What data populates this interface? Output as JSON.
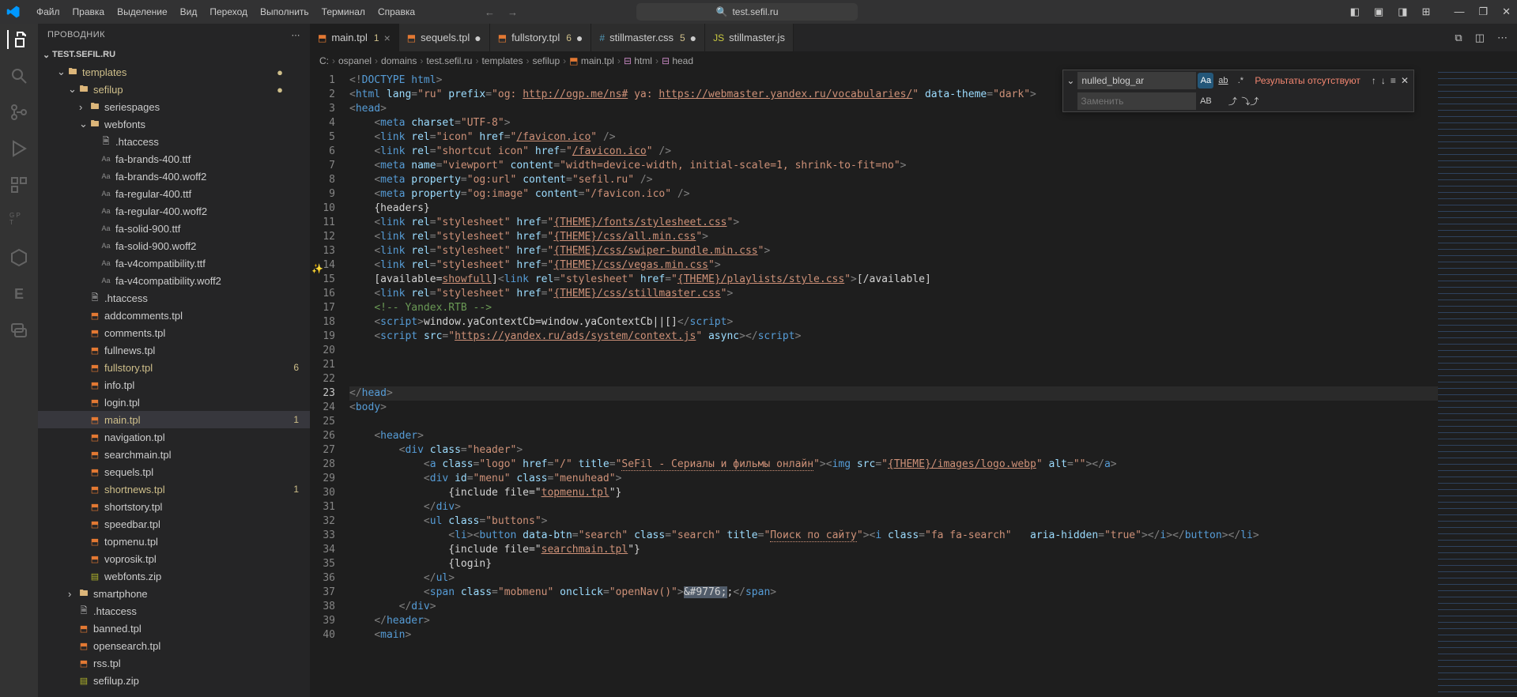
{
  "titlebar": {
    "menu": [
      "Файл",
      "Правка",
      "Выделение",
      "Вид",
      "Переход",
      "Выполнить",
      "Терминал",
      "Справка"
    ],
    "url": "test.sefil.ru"
  },
  "sidebar": {
    "title": "ПРОВОДНИК",
    "project": "TEST.SEFIL.RU",
    "tree": [
      {
        "depth": 1,
        "chev": "v",
        "icon": "folder",
        "label": "templates",
        "dim": true,
        "dot": "#cfbf8a"
      },
      {
        "depth": 2,
        "chev": "v",
        "icon": "folder",
        "label": "sefilup",
        "dim": true,
        "dot": "#cfbf8a"
      },
      {
        "depth": 3,
        "chev": ">",
        "icon": "folder",
        "label": "seriespages"
      },
      {
        "depth": 3,
        "chev": "v",
        "icon": "folder",
        "label": "webfonts"
      },
      {
        "depth": 4,
        "icon": "file",
        "label": ".htaccess"
      },
      {
        "depth": 4,
        "icon": "font",
        "label": "fa-brands-400.ttf"
      },
      {
        "depth": 4,
        "icon": "font",
        "label": "fa-brands-400.woff2"
      },
      {
        "depth": 4,
        "icon": "font",
        "label": "fa-regular-400.ttf"
      },
      {
        "depth": 4,
        "icon": "font",
        "label": "fa-regular-400.woff2"
      },
      {
        "depth": 4,
        "icon": "font",
        "label": "fa-solid-900.ttf"
      },
      {
        "depth": 4,
        "icon": "font",
        "label": "fa-solid-900.woff2"
      },
      {
        "depth": 4,
        "icon": "font",
        "label": "fa-v4compatibility.ttf"
      },
      {
        "depth": 4,
        "icon": "font",
        "label": "fa-v4compatibility.woff2"
      },
      {
        "depth": 3,
        "icon": "file",
        "label": ".htaccess"
      },
      {
        "depth": 3,
        "icon": "html5",
        "label": "addcomments.tpl"
      },
      {
        "depth": 3,
        "icon": "html5",
        "label": "comments.tpl"
      },
      {
        "depth": 3,
        "icon": "html5",
        "label": "fullnews.tpl"
      },
      {
        "depth": 3,
        "icon": "html5",
        "label": "fullstory.tpl",
        "dim": true,
        "badge": "6"
      },
      {
        "depth": 3,
        "icon": "html5",
        "label": "info.tpl"
      },
      {
        "depth": 3,
        "icon": "html5",
        "label": "login.tpl"
      },
      {
        "depth": 3,
        "icon": "html5",
        "label": "main.tpl",
        "dim": true,
        "badge": "1",
        "selected": true
      },
      {
        "depth": 3,
        "icon": "html5",
        "label": "navigation.tpl"
      },
      {
        "depth": 3,
        "icon": "html5",
        "label": "searchmain.tpl"
      },
      {
        "depth": 3,
        "icon": "html5",
        "label": "sequels.tpl"
      },
      {
        "depth": 3,
        "icon": "html5",
        "label": "shortnews.tpl",
        "dim": true,
        "badge": "1"
      },
      {
        "depth": 3,
        "icon": "html5",
        "label": "shortstory.tpl"
      },
      {
        "depth": 3,
        "icon": "html5",
        "label": "speedbar.tpl"
      },
      {
        "depth": 3,
        "icon": "html5",
        "label": "topmenu.tpl"
      },
      {
        "depth": 3,
        "icon": "html5",
        "label": "voprosik.tpl"
      },
      {
        "depth": 3,
        "icon": "zip",
        "label": "webfonts.zip"
      },
      {
        "depth": 2,
        "chev": ">",
        "icon": "folder",
        "label": "smartphone"
      },
      {
        "depth": 2,
        "icon": "file",
        "label": ".htaccess"
      },
      {
        "depth": 2,
        "icon": "html5",
        "label": "banned.tpl"
      },
      {
        "depth": 2,
        "icon": "html5",
        "label": "opensearch.tpl"
      },
      {
        "depth": 2,
        "icon": "html5",
        "label": "rss.tpl"
      },
      {
        "depth": 2,
        "icon": "zip",
        "label": "sefilup.zip",
        "cut": true
      }
    ]
  },
  "tabs": [
    {
      "icon": "html5",
      "label": "main.tpl",
      "mod": "1",
      "close": true,
      "active": true
    },
    {
      "icon": "html5",
      "label": "sequels.tpl",
      "dot": true
    },
    {
      "icon": "html5",
      "label": "fullstory.tpl",
      "mod": "6",
      "dot": true
    },
    {
      "icon": "css",
      "label": "stillmaster.css",
      "mod": "5",
      "dot": true
    },
    {
      "icon": "js",
      "label": "stillmaster.js"
    }
  ],
  "breadcrumb": [
    "C:",
    "ospanel",
    "domains",
    "test.sefil.ru",
    "templates",
    "sefilup",
    "main.tpl",
    "html",
    "head"
  ],
  "find": {
    "search": "nulled_blog_ar",
    "replace_placeholder": "Заменить",
    "status": "Результаты отсутствуют",
    "option_aa": "Aa",
    "option_ab": "ab",
    "option_regex": ".*",
    "replace_option": "AB"
  },
  "line_numbers": [
    1,
    2,
    3,
    4,
    5,
    6,
    7,
    8,
    9,
    10,
    11,
    12,
    13,
    14,
    15,
    16,
    17,
    18,
    19,
    20,
    21,
    22,
    23,
    24,
    25,
    26,
    27,
    28,
    29,
    30,
    31,
    32,
    33,
    34,
    35,
    36,
    37,
    38,
    39,
    40
  ],
  "current_line": 23,
  "code_text": {
    "doctype_open": "<!",
    "doctype": "DOCTYPE",
    "doctype_html": " html",
    "lang": "ru",
    "prefix_og": "og: ",
    "ogp_url": "http://ogp.me/ns#",
    "prefix_ya": " ya: ",
    "yandex_url": "https://webmaster.yandex.ru/vocabularies/",
    "data_theme": "dark",
    "charset": "UTF-8",
    "icon": "icon",
    "favicon": "/favicon.ico",
    "shortcut": "shortcut icon",
    "viewport_name": "viewport",
    "viewport_content": "width=device-width, initial-scale=1, shrink-to-fit=no",
    "ogurl": "og:url",
    "sefil": "sefil.ru",
    "ogimage": "og:image",
    "faviconico": "/favicon.ico",
    "headers": "{headers}",
    "stylesheet": "stylesheet",
    "theme_fonts": "{THEME}/fonts/stylesheet.css",
    "theme_all": "{THEME}/css/all.min.css",
    "theme_swiper": "{THEME}/css/swiper-bundle.min.css",
    "theme_vegas": "{THEME}/css/vegas.min.css",
    "available": "[available=",
    "showfull": "showfull",
    "theme_playlists": "{THEME}/playlists/style.css",
    "available_close": "[/available]",
    "theme_still": "{THEME}/css/stillmaster.css",
    "yandex_comment": "<!-- Yandex.RTB -->",
    "yacontext": "window.yaContextCb=window.yaContextCb||[]",
    "yandex_src": "https://yandex.ru/ads/system/context.js",
    "async": " async",
    "header_class": "header",
    "logo_class": "logo",
    "slash": "/",
    "title_text": "SeFil - Сериалы и фильмы онлайн",
    "logo_webp": "{THEME}/images/logo.webp",
    "menu_id": "menu",
    "menuhead": "menuhead",
    "include_top": "{include file=\"",
    "topmenu": "topmenu.tpl",
    "buttons": "buttons",
    "databtn": "search",
    "search_class": "search",
    "search_title": "Поиск по сайту",
    "fa_search": "fa fa-search",
    "aria_true": "true",
    "searchmain": "searchmain.tpl",
    "login": "{login}",
    "mobmenu": "mobmenu",
    "opennav": "openNav()",
    "hamburger": "&#9776;"
  }
}
